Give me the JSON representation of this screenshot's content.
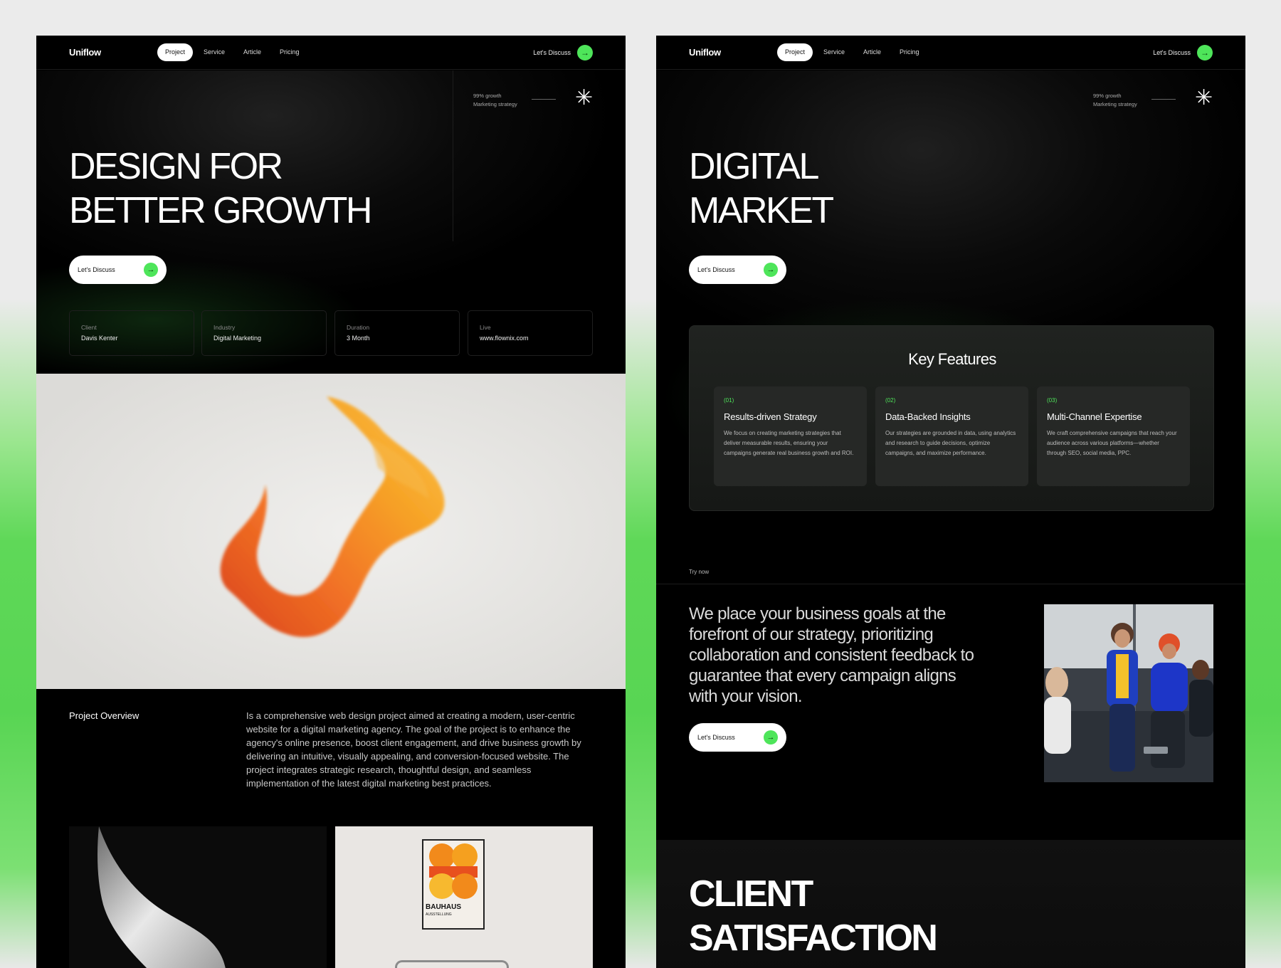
{
  "left": {
    "nav": {
      "logo": "Uniflow",
      "links": [
        "Project",
        "Service",
        "Article",
        "Pricing"
      ],
      "cta": "Let's Discuss"
    },
    "hero": {
      "stat_line1": "99% growth",
      "stat_line2": "Marketing strategy",
      "title_line1": "DESIGN FOR",
      "title_line2": "BETTER GROWTH",
      "button": "Let's Discuss"
    },
    "info": [
      {
        "label": "Client",
        "value": "Davis Kenter"
      },
      {
        "label": "Industry",
        "value": "Digital Marketing"
      },
      {
        "label": "Duration",
        "value": "3 Month"
      },
      {
        "label": "Live",
        "value": "www.flownix.com"
      }
    ],
    "overview": {
      "title": "Project Overview",
      "text": "Is a comprehensive web design project aimed at creating a modern, user-centric website for a digital marketing agency. The goal of the project is to enhance the agency's online presence, boost client engagement, and drive business growth by delivering an intuitive, visually appealing, and conversion-focused website. The project integrates strategic research, thoughtful design, and seamless implementation of the latest digital marketing best practices."
    },
    "poster": {
      "line1": "BAUHAUS",
      "line2": "AUSSTELLUNG"
    }
  },
  "right": {
    "nav": {
      "logo": "Uniflow",
      "links": [
        "Project",
        "Service",
        "Article",
        "Pricing"
      ],
      "cta": "Let's Discuss"
    },
    "hero": {
      "stat_line1": "99% growth",
      "stat_line2": "Marketing strategy",
      "title_line1": "DIGITAL",
      "title_line2": "MARKET",
      "button": "Let's Discuss"
    },
    "features": {
      "title": "Key Features",
      "items": [
        {
          "num": "(01)",
          "title": "Results-driven Strategy",
          "desc": "We focus on creating marketing strategies that deliver measurable results, ensuring your campaigns generate real business growth and ROI."
        },
        {
          "num": "(02)",
          "title": "Data-Backed Insights",
          "desc": "Our strategies are grounded in data, using analytics and research to guide decisions, optimize campaigns, and maximize performance."
        },
        {
          "num": "(03)",
          "title": "Multi-Channel Expertise",
          "desc": "We craft comprehensive campaigns that reach your audience across various platforms—whether through SEO, social media, PPC."
        }
      ]
    },
    "try_now": "Try now",
    "quote": "We place your business goals at the forefront of our strategy, prioritizing collaboration and consistent feedback to guarantee that every campaign aligns with your vision.",
    "quote_button": "Let's Discuss",
    "clients": {
      "title_line1": "CLIENT",
      "title_line2": "SATISFACTION"
    }
  },
  "colors": {
    "accent": "#4ee55a",
    "background": "#000000",
    "page_gradient_green": "#58d553"
  },
  "icons": [
    "arrow-right-icon",
    "asterisk-icon"
  ]
}
